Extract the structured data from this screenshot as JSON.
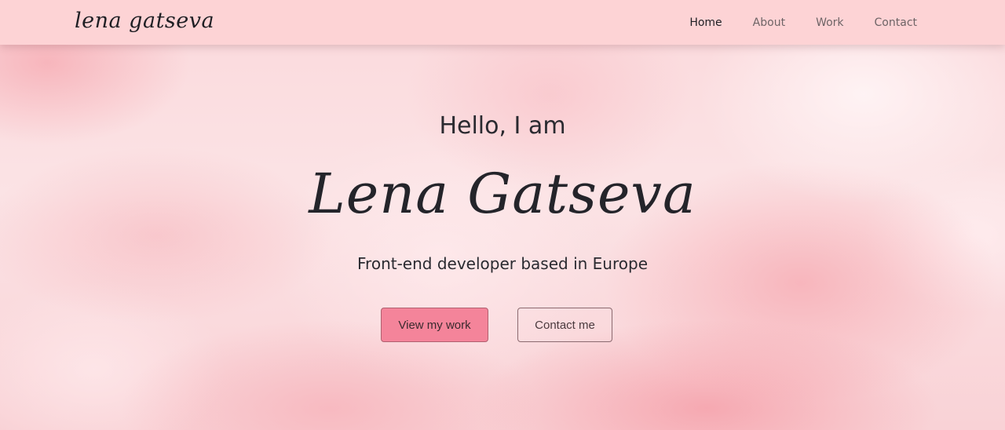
{
  "nav": {
    "logo": "lena gatseva",
    "links": [
      {
        "label": "Home",
        "active": true
      },
      {
        "label": "About",
        "active": false
      },
      {
        "label": "Work",
        "active": false
      },
      {
        "label": "Contact",
        "active": false
      }
    ]
  },
  "hero": {
    "greeting": "Hello, I am",
    "name": "Lena Gatseva",
    "tagline": "Front-end developer based in Europe",
    "primary_button": "View my work",
    "secondary_button": "Contact me"
  },
  "colors": {
    "navbar_bg": "#fdd3d5",
    "primary_button_bg": "#f4849a",
    "text_dark": "#2a2a30"
  }
}
